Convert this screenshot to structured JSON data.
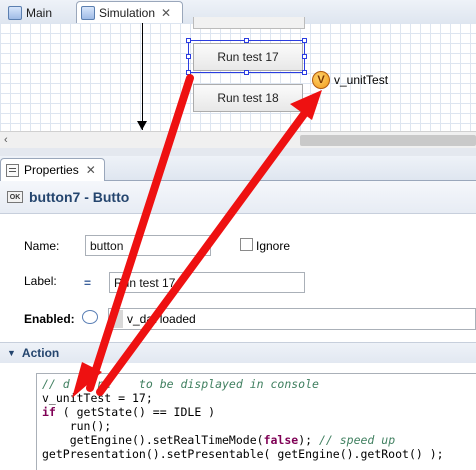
{
  "tabs": [
    {
      "label": "Main",
      "icon": "model-icon"
    },
    {
      "label": "Simulation",
      "icon": "simulation-icon",
      "close": "✕"
    }
  ],
  "canvas": {
    "button_17_label": "Run test 17",
    "button_18_label": "Run test 18",
    "variable_icon_letter": "V",
    "variable_label": "v_unitTest"
  },
  "scrollbar": {
    "left_arrow": "‹"
  },
  "properties": {
    "tab_label": "Properties",
    "tab_close": "✕",
    "title": "button7 - Butto",
    "title_icon_text": "OK",
    "name_label": "Name:",
    "name_value": "button",
    "ignore_label": "Ignore",
    "label_label": "Label:",
    "label_icon": "=",
    "label_value": "Run test 17",
    "enabled_label": "Enabled:",
    "enabled_value": "v_dat  loaded",
    "section_title": "Action",
    "section_toggle": "▼"
  },
  "code": {
    "line1_comment": "// d    ne    to be displayed in console",
    "line2": "v_unitTest = 17;",
    "line3_kw": "if",
    "line3_rest": " ( getState() == IDLE )",
    "line4": "    run();",
    "line5_pre": "    getEngine().setRealTimeMode(",
    "line5_kw": "false",
    "line5_post": "); ",
    "line5_comment": "// speed up",
    "line6": "getPresentation().setPresentable( getEngine().getRoot() );"
  },
  "colors": {
    "arrow": "#ee1111",
    "selection": "#2b3de0"
  }
}
